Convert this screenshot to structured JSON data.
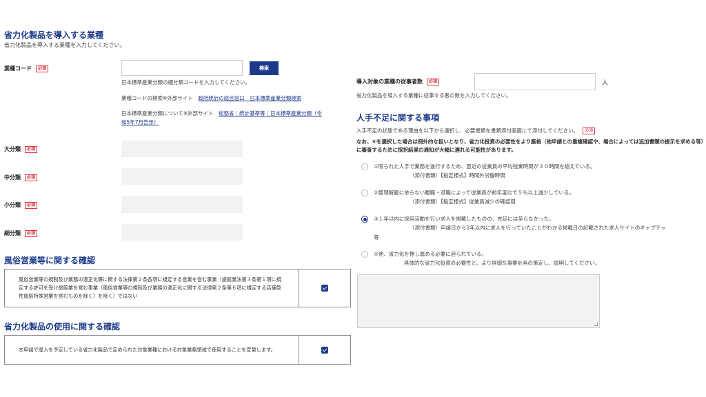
{
  "left": {
    "section1": {
      "title": "省力化製品を導入する業種",
      "subtitle": "省力化製品を導入する業種を入力してください。"
    },
    "industry_code": {
      "label": "業種コード",
      "required": "必須",
      "value": "",
      "search_button": "検索",
      "hint": "日本標準産業分類の細分類コードを入力してください。",
      "search_prefix": "業種コードの検索※外部サイト",
      "search_link": "政府統計の総合窓口　日本標準産業分類検索",
      "about_prefix": "日本標準産業分類について※外部サイト",
      "about_link_1": "総務省｜統計基準等｜日本標準産業分類（令",
      "about_link_2": "和5年7月告示）"
    },
    "major": {
      "label": "大分類",
      "required": "必須"
    },
    "medium": {
      "label": "中分類",
      "required": "必須"
    },
    "minor": {
      "label": "小分類",
      "required": "必須"
    },
    "detail": {
      "label": "細分類",
      "required": "必須"
    },
    "section2": {
      "title": "風俗営業等に関する確認",
      "text": "風俗営業等の規制及び業務の適正化等に関する法律第２条各項に規定する営業を営む事業（旅館業法第３条第１項に規定する許可を受け旅館業を営む事業（風俗営業等の規制及び業務の適正化に関する法律第２条第６項に規定する店舗型性風俗特殊営業を営むものを除く）を除く）ではない",
      "checked": true
    },
    "section3": {
      "title": "省力化製品の使用に関する確認",
      "text": "本申請で導入を予定している省力化製品で定められた対象業種における対象業務領域で使用することを宣誓します。",
      "checked": true
    }
  },
  "right": {
    "employees": {
      "label": "導入対象の業種の従事者数",
      "required": "必須",
      "unit": "人",
      "hint": "省力化製品を導入する業種に従事する者の数を入力してください。"
    },
    "labor": {
      "title": "人手不足に関する事項",
      "desc": "人手不足の状態である理由を以下から選択し、必要書類を書類添付画面にて添付してください。",
      "required": "必須",
      "warning": "なお、④を選択した場合は例外的な扱いとなり、省力化投資の必要性をより厳格（他申請との重複確認や、場合によっては追加書類の提示を求める等）に審査するために採択結果の通知が大幅に遅れる可能性があります。",
      "options": [
        {
          "text": "①限られた人手で業務を遂行するため、直近の従業員の平均残業時間が３０時間を超えている。",
          "sub": "（添付書類）【指定様式】時間外労働時間",
          "sub2": "",
          "selected": false
        },
        {
          "text": "②整理解雇に依らない離職・退職によって従業員が前年度比で５％以上減少している。",
          "sub": "（添付書類）【指定様式】従業員減少の確認用",
          "sub2": "",
          "selected": false
        },
        {
          "text": "③１年以内に採用活動を行い求人を掲載したものの、充足には至らなかった。",
          "sub": "（添付書類）申請日から1年以内に求人を行っていたことがわかる掲載日の記載された求人サイトのキャプチャ",
          "sub2": "等",
          "selected": true
        },
        {
          "text": "④他、省力化を推し進める必要に迫られている。",
          "sub": "具体的な省力化投資の必要性と、より詳細な事業計画の策定し、説明してください。",
          "sub2": "",
          "selected": false
        }
      ]
    }
  },
  "colors": {
    "accent": "#1d3a8a",
    "required": "#d9363e",
    "field_bg": "#f2f2f2"
  }
}
